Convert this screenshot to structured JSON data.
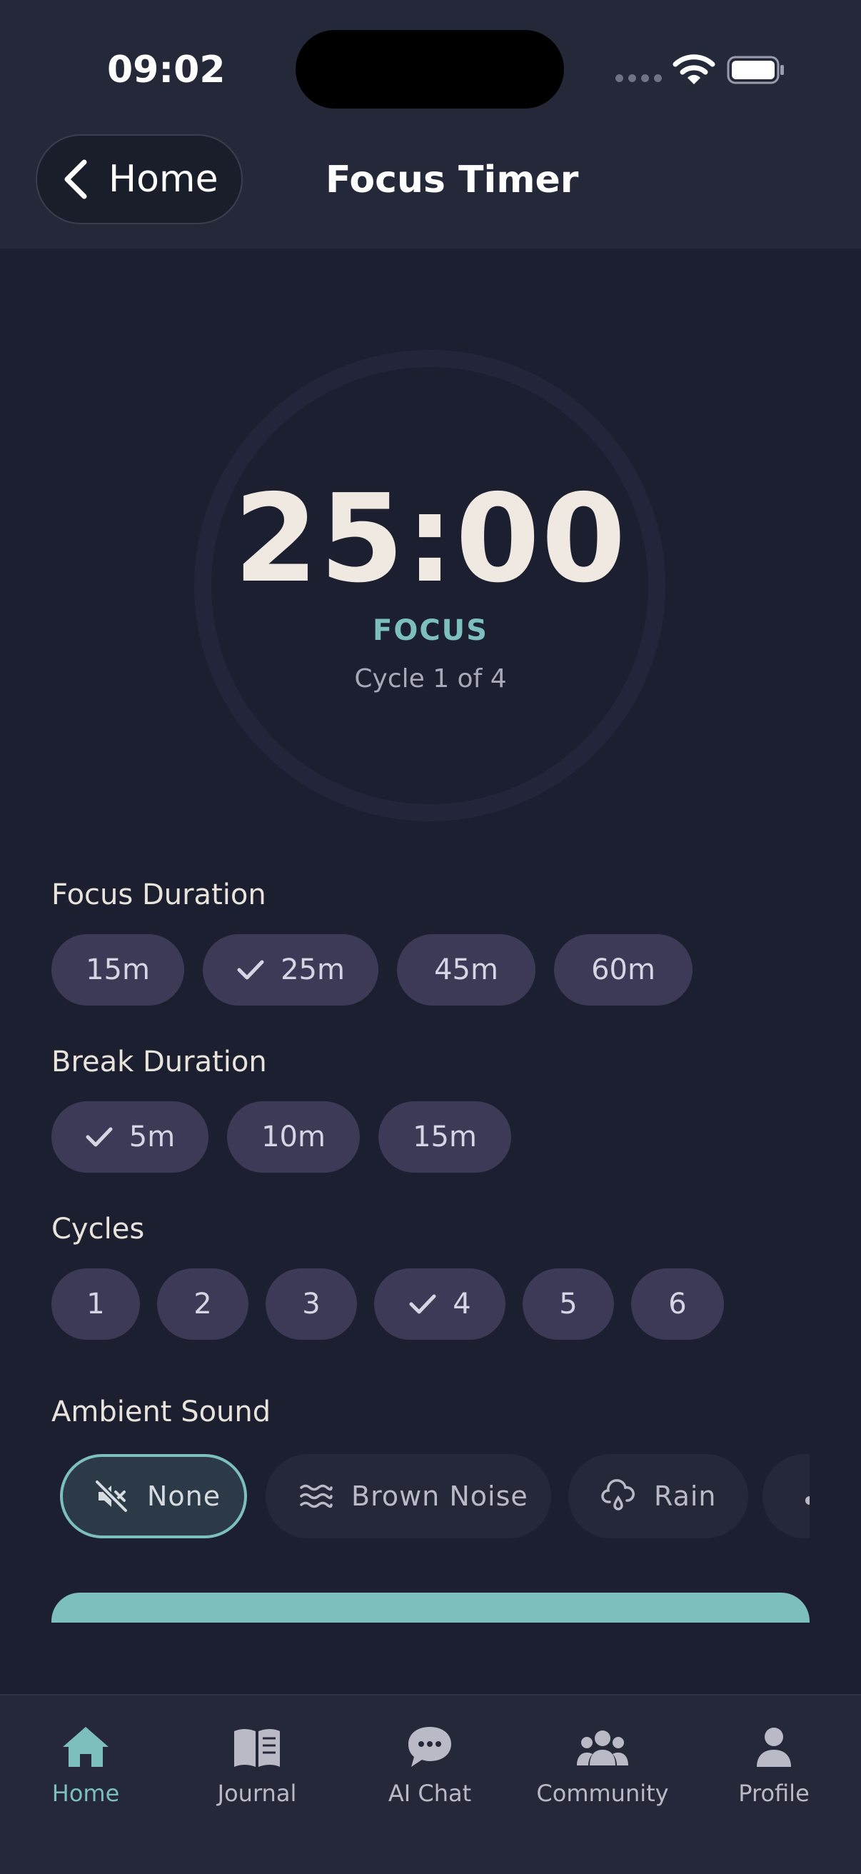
{
  "status_bar": {
    "time": "09:02"
  },
  "header": {
    "back_label": "Home",
    "title": "Focus Timer"
  },
  "timer": {
    "time": "25:00",
    "phase": "FOCUS",
    "cycle_text": "Cycle 1 of 4"
  },
  "focus_duration": {
    "label": "Focus Duration",
    "options": [
      "15m",
      "25m",
      "45m",
      "60m"
    ],
    "selected": "25m"
  },
  "break_duration": {
    "label": "Break Duration",
    "options": [
      "5m",
      "10m",
      "15m"
    ],
    "selected": "5m"
  },
  "cycles": {
    "label": "Cycles",
    "options": [
      "1",
      "2",
      "3",
      "4",
      "5",
      "6"
    ],
    "selected": "4"
  },
  "ambient_sound": {
    "label": "Ambient Sound",
    "options": [
      {
        "label": "None",
        "icon": "muted-speaker-icon"
      },
      {
        "label": "Brown Noise",
        "icon": "waves-icon"
      },
      {
        "label": "Rain",
        "icon": "rain-cloud-icon"
      }
    ],
    "selected": "None"
  },
  "tabs": [
    {
      "label": "Home",
      "icon": "home-icon",
      "active": true
    },
    {
      "label": "Journal",
      "icon": "book-icon",
      "active": false
    },
    {
      "label": "AI Chat",
      "icon": "chat-bubble-icon",
      "active": false
    },
    {
      "label": "Community",
      "icon": "people-icon",
      "active": false
    },
    {
      "label": "Profile",
      "icon": "person-icon",
      "active": false
    }
  ],
  "colors": {
    "background": "#1c1f30",
    "accent": "#7dbfbd",
    "chip": "#3d3a57",
    "panel": "#242838"
  }
}
